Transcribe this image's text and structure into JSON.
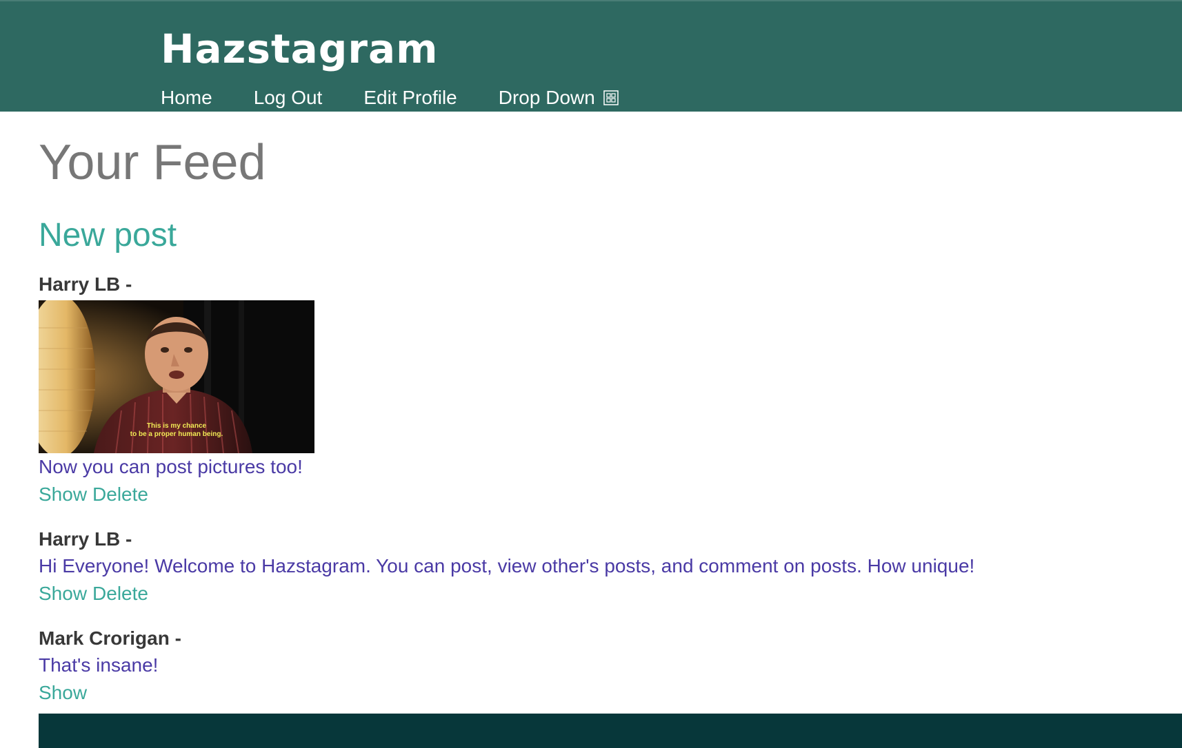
{
  "header": {
    "brand": "Hazstagram",
    "nav": [
      {
        "label": "Home"
      },
      {
        "label": "Log Out"
      },
      {
        "label": "Edit Profile"
      },
      {
        "label": "Drop Down",
        "icon": "dropdown-glyph-icon"
      }
    ]
  },
  "page": {
    "title": "Your Feed",
    "new_post_label": "New post"
  },
  "posts": [
    {
      "author": "Harry LB -",
      "has_image": true,
      "image_caption": [
        "This is my chance",
        "to be a proper human being."
      ],
      "text": "Now you can post pictures too!",
      "actions": [
        "Show",
        "Delete"
      ]
    },
    {
      "author": "Harry LB -",
      "has_image": false,
      "text": "Hi Everyone! Welcome to Hazstagram. You can post, view other's posts, and comment on posts. How unique!",
      "actions": [
        "Show",
        "Delete"
      ]
    },
    {
      "author": "Mark Crorigan -",
      "has_image": false,
      "text": "That's insane!",
      "actions": [
        "Show"
      ]
    }
  ],
  "colors": {
    "header_bg": "#2e6961",
    "footer_bg": "#07373a",
    "title_gray": "#777777",
    "link_teal": "#3aa89a",
    "post_text_purple": "#4a3aa5",
    "author_dark": "#383838"
  }
}
